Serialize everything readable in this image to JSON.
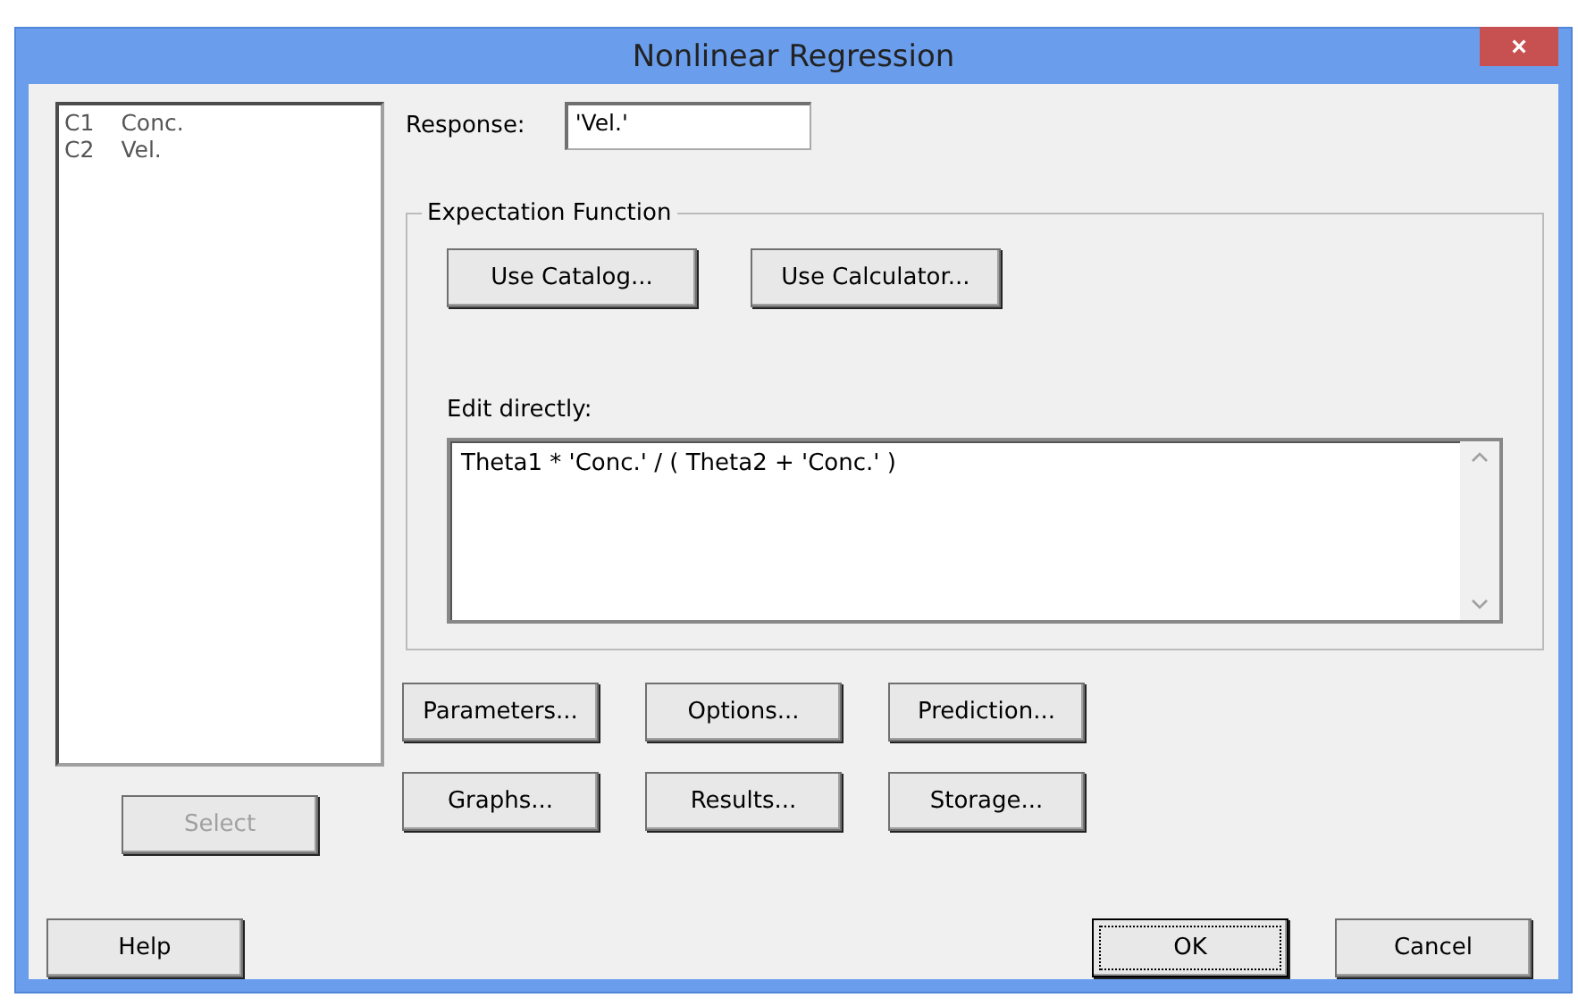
{
  "window": {
    "title": "Nonlinear Regression",
    "close": "×"
  },
  "variables": [
    {
      "column": "C1",
      "name": "Conc."
    },
    {
      "column": "C2",
      "name": "Vel."
    }
  ],
  "select_button": {
    "label": "Select",
    "disabled": true
  },
  "response": {
    "label": "Response:",
    "value": "'Vel.'"
  },
  "expectation_function": {
    "title": "Expectation Function",
    "buttons": [
      "Use Catalog...",
      "Use Calculator..."
    ],
    "edit_label": "Edit directly:",
    "value": "Theta1 * 'Conc.' / ( Theta2 + 'Conc.' )"
  },
  "option_buttons": [
    [
      "Parameters...",
      "Options...",
      "Prediction..."
    ],
    [
      "Graphs...",
      "Results...",
      "Storage..."
    ]
  ],
  "footer": {
    "help": "Help",
    "ok": "OK",
    "cancel": "Cancel"
  }
}
